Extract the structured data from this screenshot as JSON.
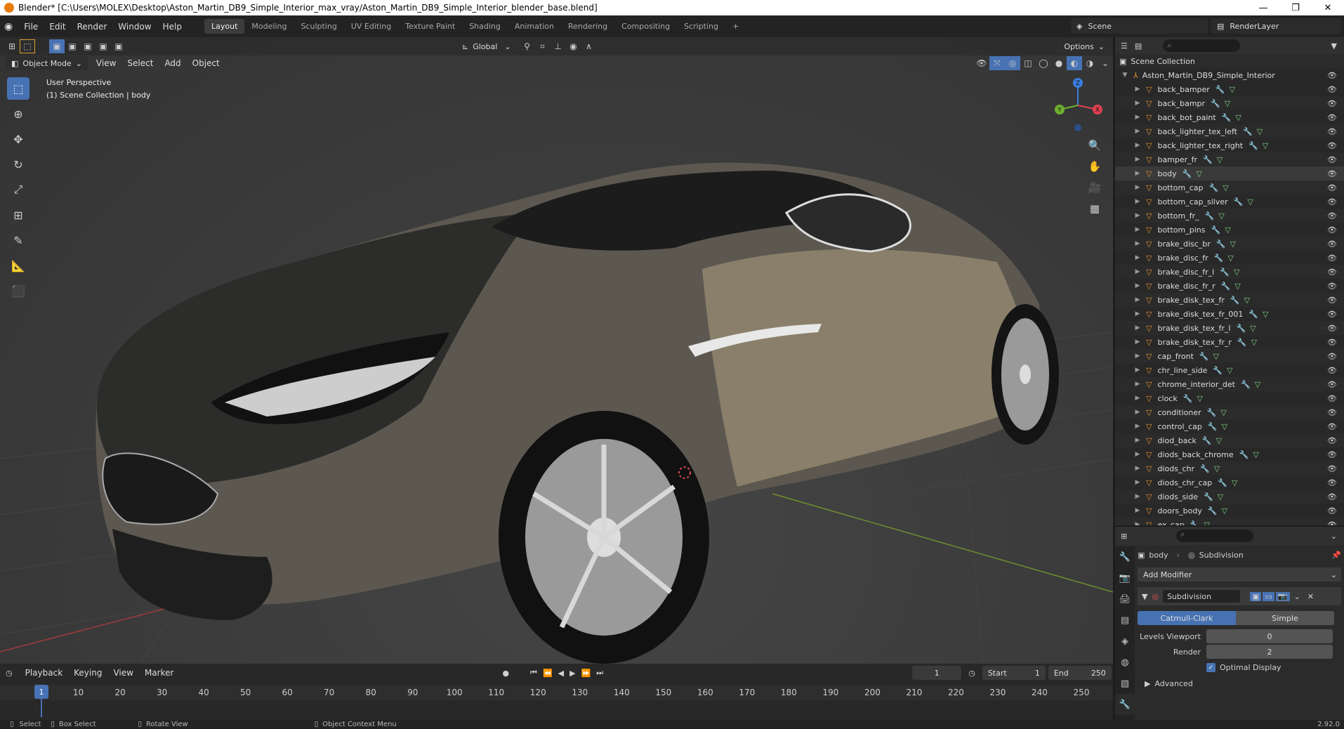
{
  "window": {
    "title": "Blender* [C:\\Users\\MOLEX\\Desktop\\Aston_Martin_DB9_Simple_Interior_max_vray/Aston_Martin_DB9_Simple_Interior_blender_base.blend]"
  },
  "menu": {
    "items": [
      "File",
      "Edit",
      "Render",
      "Window",
      "Help"
    ]
  },
  "workspaces": [
    "Layout",
    "Modeling",
    "Sculpting",
    "UV Editing",
    "Texture Paint",
    "Shading",
    "Animation",
    "Rendering",
    "Compositing",
    "Scripting"
  ],
  "active_workspace": "Layout",
  "scene": "Scene",
  "render_layer": "RenderLayer",
  "viewport": {
    "transform_orientation": "Global",
    "options_label": "Options",
    "mode": "Object Mode",
    "menus": [
      "View",
      "Select",
      "Add",
      "Object"
    ],
    "info_line1": "User Perspective",
    "info_line2": "(1) Scene Collection | body",
    "gizmo_axes": {
      "x": "X",
      "y": "Y",
      "z": "Z"
    }
  },
  "outliner": {
    "root": "Scene Collection",
    "collection": "Aston_Martin_DB9_Simple_Interior",
    "items": [
      "back_bamper",
      "back_bampr",
      "back_bot_paint",
      "back_lighter_tex_left",
      "back_lighter_tex_right",
      "bamper_fr",
      "body",
      "bottom_cap",
      "bottom_cap_silver",
      "bottom_fr_",
      "bottom_pins",
      "brake_disc_br",
      "brake_disc_fr",
      "brake_disc_fr_l",
      "brake_disc_fr_r",
      "brake_disk_tex_fr",
      "brake_disk_tex_fr_001",
      "brake_disk_tex_fr_l",
      "brake_disk_tex_fr_r",
      "cap_front",
      "chr_line_side",
      "chrome_interior_det",
      "clock",
      "conditioner",
      "control_cap",
      "diod_back",
      "diods_back_chrome",
      "diods_chr",
      "diods_chr_cap",
      "diods_side",
      "doors_body",
      "ex_cap"
    ],
    "selected": "body"
  },
  "properties": {
    "object": "body",
    "modifier_tab": "Subdivision",
    "add_modifier": "Add Modifier",
    "modifier_name": "Subdivision",
    "mode_catmull": "Catmull-Clark",
    "mode_simple": "Simple",
    "levels_viewport_label": "Levels Viewport",
    "levels_viewport_value": "0",
    "render_label": "Render",
    "render_value": "2",
    "optimal_display": "Optimal Display",
    "advanced": "Advanced"
  },
  "timeline": {
    "menus": [
      "Playback",
      "Keying",
      "View",
      "Marker"
    ],
    "current_frame": "1",
    "start_label": "Start",
    "start_value": "1",
    "end_label": "End",
    "end_value": "250",
    "ruler_labels": [
      "1",
      "10",
      "20",
      "30",
      "40",
      "50",
      "60",
      "70",
      "80",
      "90",
      "100",
      "110",
      "120",
      "130",
      "140",
      "150",
      "160",
      "170",
      "180",
      "190",
      "200",
      "210",
      "220",
      "230",
      "240",
      "250"
    ]
  },
  "statusbar": {
    "select": "Select",
    "box_select": "Box Select",
    "rotate_view": "Rotate View",
    "context_menu": "Object Context Menu",
    "version": "2.92.0"
  }
}
